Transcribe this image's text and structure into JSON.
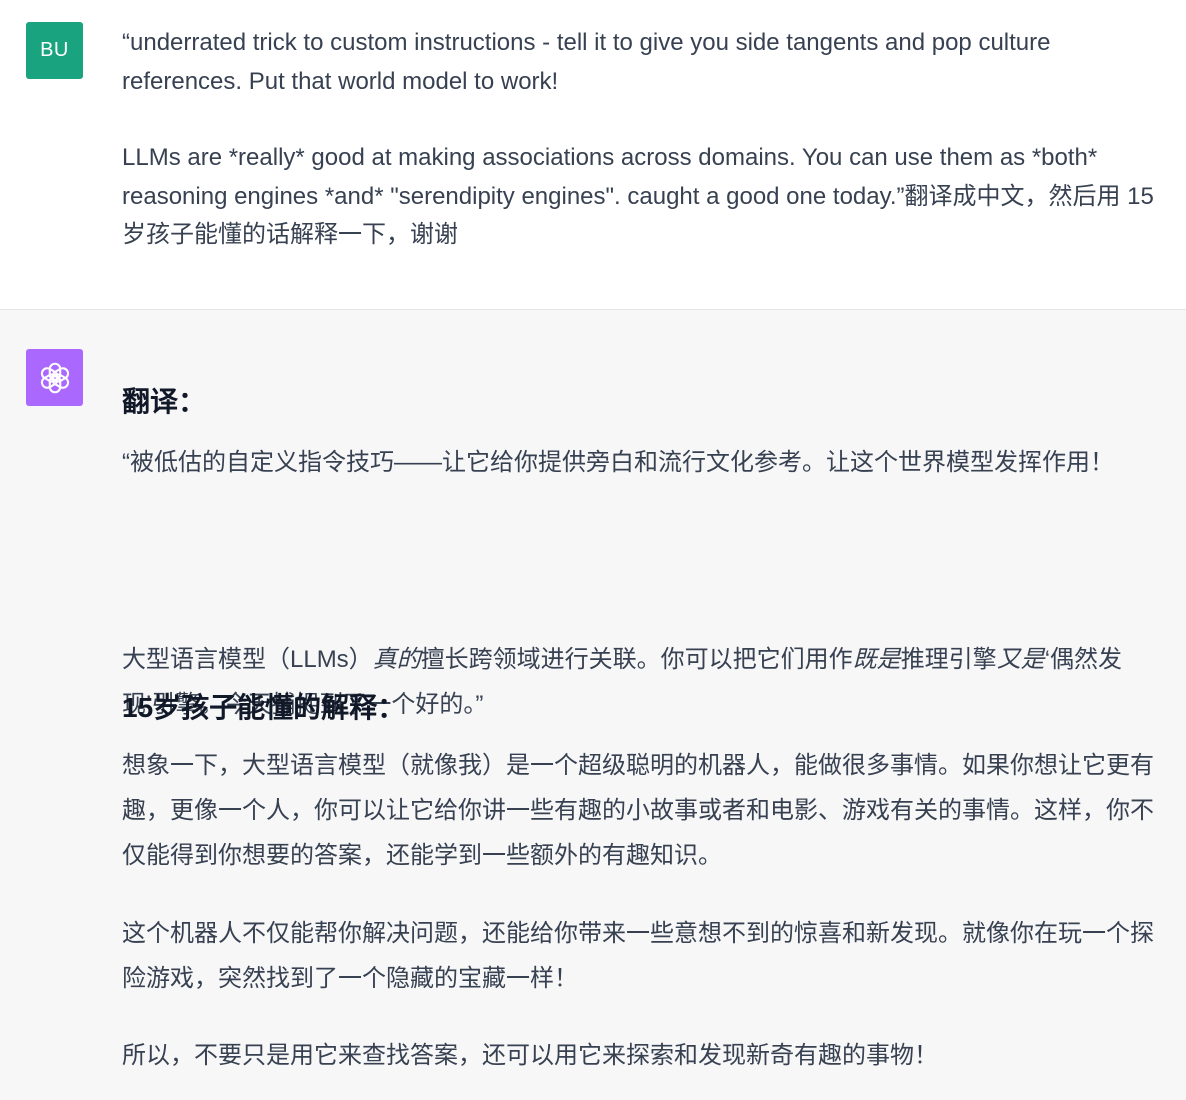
{
  "user": {
    "avatar": "BU",
    "line1": "“underrated trick to custom instructions - tell it to give you side tangents and pop culture references. Put that world model to work!",
    "line2": "LLMs are *really* good at making associations across domains. You can use them as *both* reasoning engines *and* \"serendipity engines\". caught a good one today.”翻译成中文，然后用 15 岁孩子能懂的话解释一下，谢谢"
  },
  "assistant": {
    "avatar_icon": "openai-logo-icon",
    "heading_translation": "翻译：",
    "translation_p1": "“被低估的自定义指令技巧——让它给你提供旁白和流行文化参考。让这个世界模型发挥作用！",
    "translation_p2": {
      "part1": "大型语言模型（LLMs）",
      "em1": "真的",
      "part2": "擅长跨领域进行关联。你可以把它们用作",
      "em2": "既是",
      "part3": "推理引擎",
      "em3": "又是",
      "part4": "‘偶然发现’引擎。今天捕捉到了一个好的。”"
    },
    "heading_explain": "15岁孩子能懂的解释：",
    "explain_p1": "想象一下，大型语言模型（就像我）是一个超级聪明的机器人，能做很多事情。如果你想让它更有趣，更像一个人，你可以让它给你讲一些有趣的小故事或者和电影、游戏有关的事情。这样，你不仅能得到你想要的答案，还能学到一些额外的有趣知识。",
    "explain_p2": "这个机器人不仅能帮你解决问题，还能给你带来一些意想不到的惊喜和新发现。就像你在玩一个探险游戏，突然找到了一个隐藏的宝藏一样！",
    "explain_p3": "所以，不要只是用它来查找答案，还可以用它来探索和发现新奇有趣的事物！"
  },
  "colors": {
    "user_avatar_bg": "#19a37f",
    "bot_avatar_bg": "#ab68ff",
    "assistant_row_bg": "#f7f7f8",
    "text": "#374151"
  }
}
